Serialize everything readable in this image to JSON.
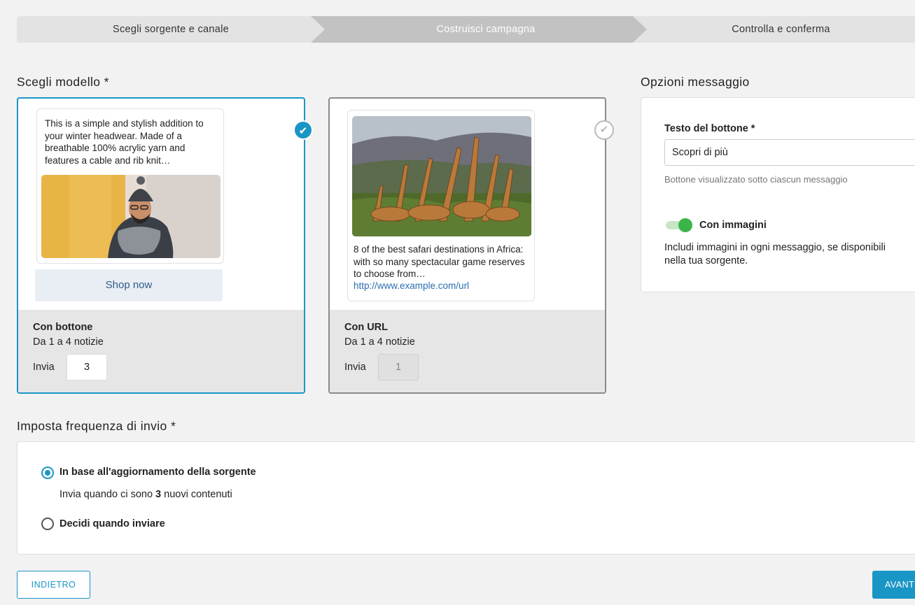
{
  "stepper": {
    "steps": [
      {
        "label": "Scegli sorgente e canale",
        "state": "done"
      },
      {
        "label": "Costruisci campagna",
        "state": "active"
      },
      {
        "label": "Controlla e conferma",
        "state": "pending"
      }
    ]
  },
  "template_section": {
    "title": "Scegli modello *",
    "cards": [
      {
        "preview_text": "This is a simple and stylish addition to your winter headwear. Made of a breathable 100% acrylic yarn and features a cable and rib knit…",
        "preview_button": "Shop now",
        "name": "Con bottone",
        "range": "Da 1 a 4 notizie",
        "send_label": "Invia",
        "send_value": "3",
        "selected": true
      },
      {
        "preview_text": "8 of the best safari destinations in Africa: with so many spectacular game reserves to choose from…",
        "preview_link": "http://www.example.com/url",
        "name": "Con URL",
        "range": "Da 1 a 4 notizie",
        "send_label": "Invia",
        "send_value": "1",
        "selected": false
      }
    ]
  },
  "options": {
    "title": "Opzioni messaggio",
    "button_text_label": "Testo del bottone *",
    "button_text_value": "Scopri di più",
    "button_text_help": "Bottone visualizzato sotto ciascun messaggio",
    "images_toggle_label": "Con immagini",
    "images_toggle_on": true,
    "images_desc": "Includi immagini in ogni messaggio, se disponibili nella tua sorgente."
  },
  "frequency": {
    "title": "Imposta frequenza di invio *",
    "option1_label": "In base all'aggiornamento della sorgente",
    "option1_sub_prefix": "Invia quando ci sono",
    "option1_sub_count": "3",
    "option1_sub_suffix": "nuovi contenuti",
    "option2_label": "Decidi quando inviare",
    "selected": 1
  },
  "actions": {
    "back_label": "INDIETRO",
    "next_label": "AVANTI"
  },
  "colors": {
    "accent": "#1a96c6",
    "toggle_on": "#3bb54a",
    "link": "#2a6fb0"
  }
}
